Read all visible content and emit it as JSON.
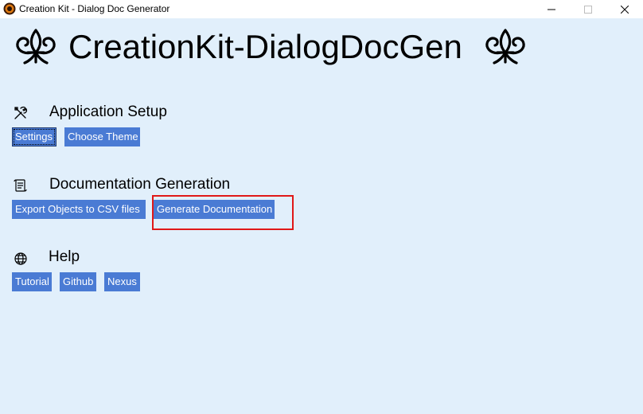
{
  "window": {
    "title": "Creation Kit - Dialog Doc Generator",
    "controls": [
      "minimize",
      "maximize",
      "close"
    ]
  },
  "app": {
    "title": "CreationKit-DialogDocGen",
    "decoration_icon": "fleur-de-lis-icon"
  },
  "sections": {
    "setup": {
      "icon": "tools-icon",
      "heading": "Application Setup",
      "buttons": {
        "settings": "Settings",
        "choose_theme": "Choose Theme"
      }
    },
    "docs": {
      "icon": "scroll-icon",
      "heading": "Documentation Generation",
      "buttons": {
        "export_csv": "Export Objects to CSV files",
        "generate_docs": "Generate Documentation"
      }
    },
    "help": {
      "icon": "globe-icon",
      "heading": "Help",
      "buttons": {
        "tutorial": "Tutorial",
        "github": "Github",
        "nexus": "Nexus"
      }
    }
  },
  "colors": {
    "background": "#e1effb",
    "button": "#4a7bd4",
    "button_text": "#ffffff",
    "highlight": "#e01818"
  }
}
